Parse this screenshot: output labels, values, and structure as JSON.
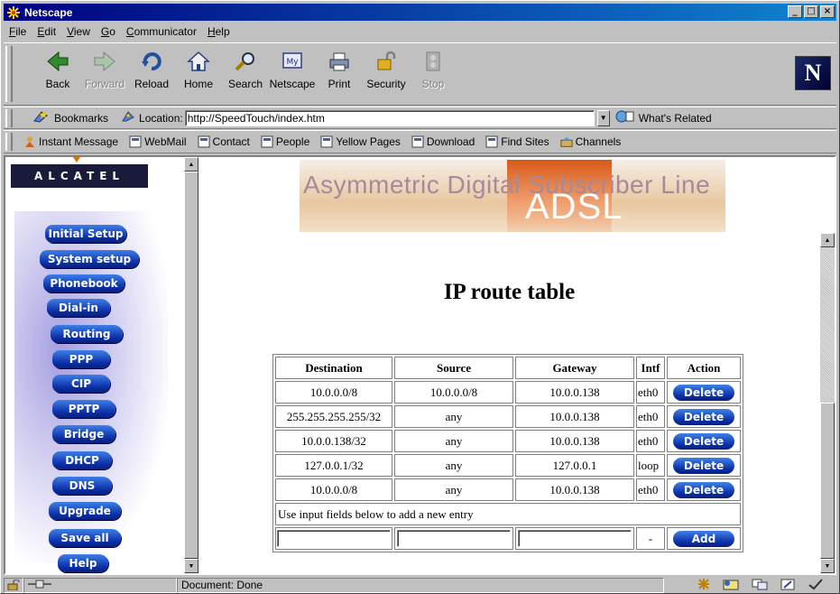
{
  "window": {
    "title": "Netscape"
  },
  "menu": [
    {
      "pre": "",
      "u": "F",
      "post": "ile"
    },
    {
      "pre": "",
      "u": "E",
      "post": "dit"
    },
    {
      "pre": "",
      "u": "V",
      "post": "iew"
    },
    {
      "pre": "",
      "u": "G",
      "post": "o"
    },
    {
      "pre": "",
      "u": "C",
      "post": "ommunicator"
    },
    {
      "pre": "",
      "u": "H",
      "post": "elp"
    }
  ],
  "toolbar": {
    "back": "Back",
    "forward": "Forward",
    "reload": "Reload",
    "home": "Home",
    "search": "Search",
    "netscape": "Netscape",
    "print": "Print",
    "security": "Security",
    "stop": "Stop",
    "my_label": "My"
  },
  "location": {
    "bookmarks": "Bookmarks",
    "label": "Location:",
    "url": "http://SpeedTouch/index.htm",
    "related": "What's Related"
  },
  "personal": [
    "Instant Message",
    "WebMail",
    "Contact",
    "People",
    "Yellow Pages",
    "Download",
    "Find Sites",
    "Channels"
  ],
  "sidebar": {
    "logo": "ALCATEL",
    "items": [
      "Initial Setup",
      "System setup",
      "Phonebook",
      "Dial-in",
      "Routing",
      "PPP",
      "CIP",
      "PPTP",
      "Bridge",
      "DHCP",
      "DNS",
      "Upgrade",
      "Save all",
      "Help"
    ]
  },
  "banner": {
    "line1": "Asymmetric Digital Subscriber Line",
    "adsl": "ADSL"
  },
  "page": {
    "title": "IP route table"
  },
  "table": {
    "headers": [
      "Destination",
      "Source",
      "Gateway",
      "Intf",
      "Action"
    ],
    "rows": [
      {
        "dest": "10.0.0.0/8",
        "src": "10.0.0.0/8",
        "gw": "10.0.0.138",
        "intf": "eth0",
        "action": "Delete"
      },
      {
        "dest": "255.255.255.255/32",
        "src": "any",
        "gw": "10.0.0.138",
        "intf": "eth0",
        "action": "Delete"
      },
      {
        "dest": "10.0.0.138/32",
        "src": "any",
        "gw": "10.0.0.138",
        "intf": "eth0",
        "action": "Delete"
      },
      {
        "dest": "127.0.0.1/32",
        "src": "any",
        "gw": "127.0.0.1",
        "intf": "loop",
        "action": "Delete"
      },
      {
        "dest": "10.0.0.0/8",
        "src": "any",
        "gw": "10.0.0.138",
        "intf": "eth0",
        "action": "Delete"
      }
    ],
    "note": "Use input fields below to add a new entry",
    "new_intf": "-",
    "add": "Add"
  },
  "status": {
    "text": "Document: Done"
  },
  "colors": {
    "titlebar": "#000080",
    "nav_button": "#0b2fa8",
    "chrome": "#c0c0c0"
  }
}
